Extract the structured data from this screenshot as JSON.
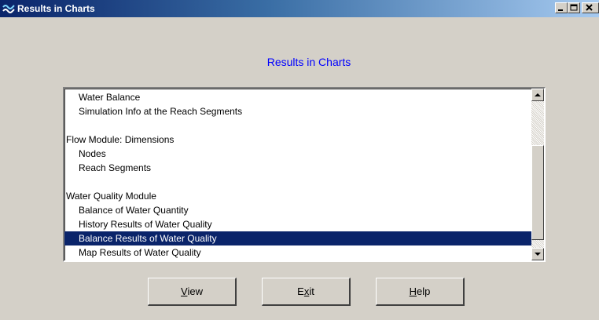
{
  "window": {
    "title": "Results in Charts",
    "icon": "water-chart-icon"
  },
  "heading": "Results in Charts",
  "list": {
    "items": [
      {
        "label": "Water Balance",
        "indent": 1,
        "selected": false
      },
      {
        "label": "Simulation Info at the Reach Segments",
        "indent": 1,
        "selected": false
      },
      {
        "label": "",
        "indent": 0,
        "selected": false
      },
      {
        "label": "Flow Module: Dimensions",
        "indent": 0,
        "selected": false
      },
      {
        "label": "Nodes",
        "indent": 1,
        "selected": false
      },
      {
        "label": "Reach Segments",
        "indent": 1,
        "selected": false
      },
      {
        "label": "",
        "indent": 0,
        "selected": false
      },
      {
        "label": "Water Quality Module",
        "indent": 0,
        "selected": false
      },
      {
        "label": "Balance of Water Quantity",
        "indent": 1,
        "selected": false
      },
      {
        "label": "History Results of Water Quality",
        "indent": 1,
        "selected": false
      },
      {
        "label": "Balance Results of Water Quality",
        "indent": 1,
        "selected": true
      },
      {
        "label": "Map Results of Water Quality",
        "indent": 1,
        "selected": false
      }
    ],
    "scroll_position": 0.85
  },
  "buttons": {
    "view": {
      "accel": "V",
      "rest": "iew"
    },
    "exit": {
      "pre": "E",
      "accel": "x",
      "rest": "it"
    },
    "help": {
      "accel": "H",
      "rest": "elp"
    }
  },
  "colors": {
    "heading": "#0000ff",
    "selection": "#0a246a",
    "face": "#d4d0c8"
  }
}
